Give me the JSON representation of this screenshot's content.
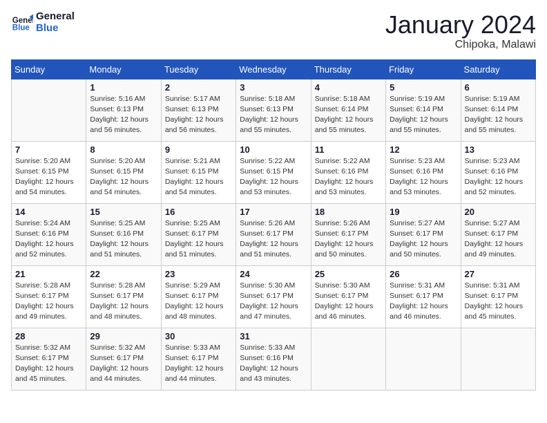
{
  "logo": {
    "line1": "General",
    "line2": "Blue"
  },
  "title": "January 2024",
  "subtitle": "Chipoka, Malawi",
  "headers": [
    "Sunday",
    "Monday",
    "Tuesday",
    "Wednesday",
    "Thursday",
    "Friday",
    "Saturday"
  ],
  "weeks": [
    [
      {
        "day": "",
        "info": ""
      },
      {
        "day": "1",
        "info": "Sunrise: 5:16 AM\nSunset: 6:13 PM\nDaylight: 12 hours\nand 56 minutes."
      },
      {
        "day": "2",
        "info": "Sunrise: 5:17 AM\nSunset: 6:13 PM\nDaylight: 12 hours\nand 56 minutes."
      },
      {
        "day": "3",
        "info": "Sunrise: 5:18 AM\nSunset: 6:13 PM\nDaylight: 12 hours\nand 55 minutes."
      },
      {
        "day": "4",
        "info": "Sunrise: 5:18 AM\nSunset: 6:14 PM\nDaylight: 12 hours\nand 55 minutes."
      },
      {
        "day": "5",
        "info": "Sunrise: 5:19 AM\nSunset: 6:14 PM\nDaylight: 12 hours\nand 55 minutes."
      },
      {
        "day": "6",
        "info": "Sunrise: 5:19 AM\nSunset: 6:14 PM\nDaylight: 12 hours\nand 55 minutes."
      }
    ],
    [
      {
        "day": "7",
        "info": "Sunrise: 5:20 AM\nSunset: 6:15 PM\nDaylight: 12 hours\nand 54 minutes."
      },
      {
        "day": "8",
        "info": "Sunrise: 5:20 AM\nSunset: 6:15 PM\nDaylight: 12 hours\nand 54 minutes."
      },
      {
        "day": "9",
        "info": "Sunrise: 5:21 AM\nSunset: 6:15 PM\nDaylight: 12 hours\nand 54 minutes."
      },
      {
        "day": "10",
        "info": "Sunrise: 5:22 AM\nSunset: 6:15 PM\nDaylight: 12 hours\nand 53 minutes."
      },
      {
        "day": "11",
        "info": "Sunrise: 5:22 AM\nSunset: 6:16 PM\nDaylight: 12 hours\nand 53 minutes."
      },
      {
        "day": "12",
        "info": "Sunrise: 5:23 AM\nSunset: 6:16 PM\nDaylight: 12 hours\nand 53 minutes."
      },
      {
        "day": "13",
        "info": "Sunrise: 5:23 AM\nSunset: 6:16 PM\nDaylight: 12 hours\nand 52 minutes."
      }
    ],
    [
      {
        "day": "14",
        "info": "Sunrise: 5:24 AM\nSunset: 6:16 PM\nDaylight: 12 hours\nand 52 minutes."
      },
      {
        "day": "15",
        "info": "Sunrise: 5:25 AM\nSunset: 6:16 PM\nDaylight: 12 hours\nand 51 minutes."
      },
      {
        "day": "16",
        "info": "Sunrise: 5:25 AM\nSunset: 6:17 PM\nDaylight: 12 hours\nand 51 minutes."
      },
      {
        "day": "17",
        "info": "Sunrise: 5:26 AM\nSunset: 6:17 PM\nDaylight: 12 hours\nand 51 minutes."
      },
      {
        "day": "18",
        "info": "Sunrise: 5:26 AM\nSunset: 6:17 PM\nDaylight: 12 hours\nand 50 minutes."
      },
      {
        "day": "19",
        "info": "Sunrise: 5:27 AM\nSunset: 6:17 PM\nDaylight: 12 hours\nand 50 minutes."
      },
      {
        "day": "20",
        "info": "Sunrise: 5:27 AM\nSunset: 6:17 PM\nDaylight: 12 hours\nand 49 minutes."
      }
    ],
    [
      {
        "day": "21",
        "info": "Sunrise: 5:28 AM\nSunset: 6:17 PM\nDaylight: 12 hours\nand 49 minutes."
      },
      {
        "day": "22",
        "info": "Sunrise: 5:28 AM\nSunset: 6:17 PM\nDaylight: 12 hours\nand 48 minutes."
      },
      {
        "day": "23",
        "info": "Sunrise: 5:29 AM\nSunset: 6:17 PM\nDaylight: 12 hours\nand 48 minutes."
      },
      {
        "day": "24",
        "info": "Sunrise: 5:30 AM\nSunset: 6:17 PM\nDaylight: 12 hours\nand 47 minutes."
      },
      {
        "day": "25",
        "info": "Sunrise: 5:30 AM\nSunset: 6:17 PM\nDaylight: 12 hours\nand 46 minutes."
      },
      {
        "day": "26",
        "info": "Sunrise: 5:31 AM\nSunset: 6:17 PM\nDaylight: 12 hours\nand 46 minutes."
      },
      {
        "day": "27",
        "info": "Sunrise: 5:31 AM\nSunset: 6:17 PM\nDaylight: 12 hours\nand 45 minutes."
      }
    ],
    [
      {
        "day": "28",
        "info": "Sunrise: 5:32 AM\nSunset: 6:17 PM\nDaylight: 12 hours\nand 45 minutes."
      },
      {
        "day": "29",
        "info": "Sunrise: 5:32 AM\nSunset: 6:17 PM\nDaylight: 12 hours\nand 44 minutes."
      },
      {
        "day": "30",
        "info": "Sunrise: 5:33 AM\nSunset: 6:17 PM\nDaylight: 12 hours\nand 44 minutes."
      },
      {
        "day": "31",
        "info": "Sunrise: 5:33 AM\nSunset: 6:16 PM\nDaylight: 12 hours\nand 43 minutes."
      },
      {
        "day": "",
        "info": ""
      },
      {
        "day": "",
        "info": ""
      },
      {
        "day": "",
        "info": ""
      }
    ]
  ]
}
